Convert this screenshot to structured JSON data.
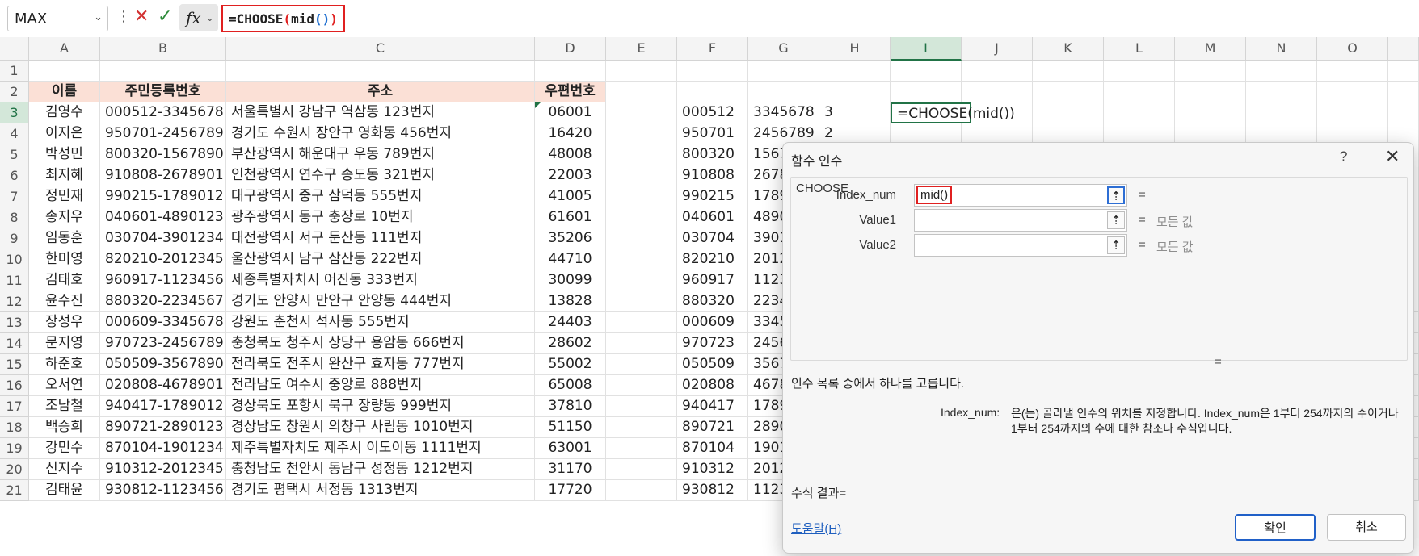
{
  "formula_bar": {
    "name_box": "MAX",
    "formula_prefix": "=CHOOSE",
    "formula_open": "(",
    "formula_fn": "mid",
    "formula_inner": "()",
    "formula_close": ")",
    "fx": "fx"
  },
  "columns": [
    "A",
    "B",
    "C",
    "D",
    "E",
    "F",
    "G",
    "H",
    "I",
    "J",
    "K",
    "L",
    "M",
    "N",
    "O"
  ],
  "header_row": {
    "name": "이름",
    "rrn": "주민등록번호",
    "address": "주소",
    "zip": "우편번호"
  },
  "active_cell_formula": "=CHOOSE(mid())",
  "rows": [
    {
      "n": "3",
      "name": "김영수",
      "rrn": "000512-3345678",
      "addr": "서울특별시 강남구 역삼동 123번지",
      "zip": "06001",
      "f": "000512",
      "g": "3345678",
      "h": "3"
    },
    {
      "n": "4",
      "name": "이지은",
      "rrn": "950701-2456789",
      "addr": "경기도 수원시 장안구 영화동 456번지",
      "zip": "16420",
      "f": "950701",
      "g": "2456789",
      "h": "2"
    },
    {
      "n": "5",
      "name": "박성민",
      "rrn": "800320-1567890",
      "addr": "부산광역시 해운대구 우동 789번지",
      "zip": "48008",
      "f": "800320",
      "g": "1567",
      "h": ""
    },
    {
      "n": "6",
      "name": "최지혜",
      "rrn": "910808-2678901",
      "addr": "인천광역시 연수구 송도동 321번지",
      "zip": "22003",
      "f": "910808",
      "g": "2678",
      "h": ""
    },
    {
      "n": "7",
      "name": "정민재",
      "rrn": "990215-1789012",
      "addr": "대구광역시 중구 삼덕동 555번지",
      "zip": "41005",
      "f": "990215",
      "g": "1789",
      "h": ""
    },
    {
      "n": "8",
      "name": "송지우",
      "rrn": "040601-4890123",
      "addr": "광주광역시 동구 충장로 10번지",
      "zip": "61601",
      "f": "040601",
      "g": "4890",
      "h": ""
    },
    {
      "n": "9",
      "name": "임동훈",
      "rrn": "030704-3901234",
      "addr": "대전광역시 서구 둔산동 111번지",
      "zip": "35206",
      "f": "030704",
      "g": "3901",
      "h": ""
    },
    {
      "n": "10",
      "name": "한미영",
      "rrn": "820210-2012345",
      "addr": "울산광역시 남구 삼산동 222번지",
      "zip": "44710",
      "f": "820210",
      "g": "2012",
      "h": ""
    },
    {
      "n": "11",
      "name": "김태호",
      "rrn": "960917-1123456",
      "addr": "세종특별자치시 어진동 333번지",
      "zip": "30099",
      "f": "960917",
      "g": "1123",
      "h": ""
    },
    {
      "n": "12",
      "name": "윤수진",
      "rrn": "880320-2234567",
      "addr": "경기도 안양시 만안구 안양동 444번지",
      "zip": "13828",
      "f": "880320",
      "g": "2234",
      "h": ""
    },
    {
      "n": "13",
      "name": "장성우",
      "rrn": "000609-3345678",
      "addr": "강원도 춘천시 석사동 555번지",
      "zip": "24403",
      "f": "000609",
      "g": "3345",
      "h": ""
    },
    {
      "n": "14",
      "name": "문지영",
      "rrn": "970723-2456789",
      "addr": "충청북도 청주시 상당구 용암동 666번지",
      "zip": "28602",
      "f": "970723",
      "g": "2456",
      "h": ""
    },
    {
      "n": "15",
      "name": "하준호",
      "rrn": "050509-3567890",
      "addr": "전라북도 전주시 완산구 효자동 777번지",
      "zip": "55002",
      "f": "050509",
      "g": "3567",
      "h": ""
    },
    {
      "n": "16",
      "name": "오서연",
      "rrn": "020808-4678901",
      "addr": "전라남도 여수시 중앙로 888번지",
      "zip": "65008",
      "f": "020808",
      "g": "4678",
      "h": ""
    },
    {
      "n": "17",
      "name": "조남철",
      "rrn": "940417-1789012",
      "addr": "경상북도 포항시 북구 장량동 999번지",
      "zip": "37810",
      "f": "940417",
      "g": "1789",
      "h": ""
    },
    {
      "n": "18",
      "name": "백승희",
      "rrn": "890721-2890123",
      "addr": "경상남도 창원시 의창구 사림동 1010번지",
      "zip": "51150",
      "f": "890721",
      "g": "2890",
      "h": ""
    },
    {
      "n": "19",
      "name": "강민수",
      "rrn": "870104-1901234",
      "addr": "제주특별자치도 제주시 이도이동 1111번지",
      "zip": "63001",
      "f": "870104",
      "g": "1901",
      "h": ""
    },
    {
      "n": "20",
      "name": "신지수",
      "rrn": "910312-2012345",
      "addr": "충청남도 천안시 동남구 성정동 1212번지",
      "zip": "31170",
      "f": "910312",
      "g": "2012",
      "h": ""
    },
    {
      "n": "21",
      "name": "김태윤",
      "rrn": "930812-1123456",
      "addr": "경기도 평택시 서정동 1313번지",
      "zip": "17720",
      "f": "930812",
      "g": "1123",
      "h": ""
    }
  ],
  "dialog": {
    "title": "함수 인수",
    "help": "?",
    "close": "✕",
    "function_name": "CHOOSE",
    "args": [
      {
        "label": "Index_num",
        "value": "mid()",
        "eq": "=",
        "eq_value": ""
      },
      {
        "label": "Value1",
        "value": "",
        "eq": "=",
        "eq_value": "모든 값"
      },
      {
        "label": "Value2",
        "value": "",
        "eq": "=",
        "eq_value": "모든 값"
      }
    ],
    "collapse_icon": "⇡",
    "result_eq": "=",
    "description": "인수 목록 중에서 하나를 고릅니다.",
    "arg_desc_name": "Index_num:",
    "arg_desc_text": "은(는) 골라낼 인수의 위치를 지정합니다. Index_num은 1부터 254까지의 수이거나 1부터 254까지의 수에 대한 참조나 수식입니다.",
    "result_label": "수식 결과=",
    "help_link": "도움말(H)",
    "ok": "확인",
    "cancel": "취소"
  },
  "colors": {
    "accent_red": "#e02020",
    "excel_green": "#217346",
    "header_fill": "#fbe0d6",
    "link_blue": "#1f5fbf"
  }
}
